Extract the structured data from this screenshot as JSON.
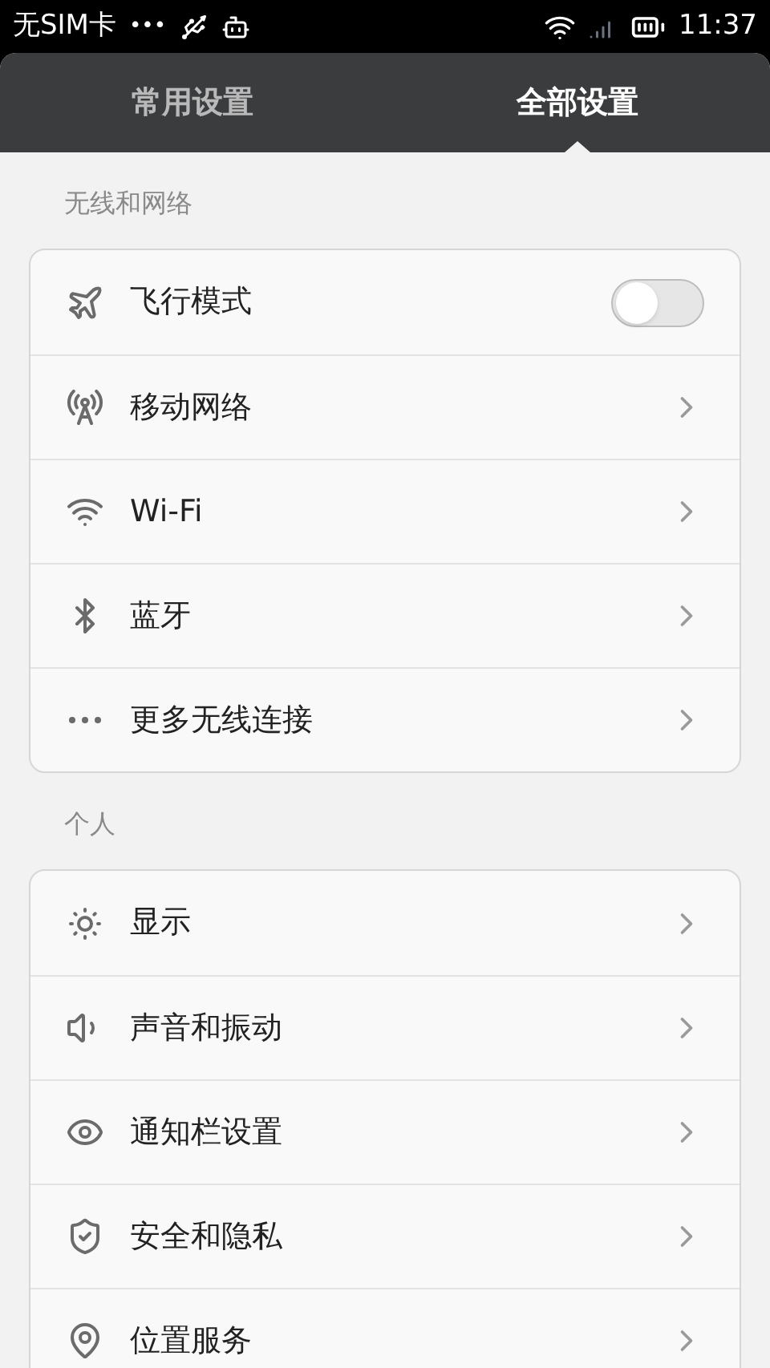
{
  "status_bar": {
    "carrier": "无SIM卡",
    "dots": "•••",
    "time": "11:37"
  },
  "tabs": [
    {
      "label": "常用设置",
      "selected": false
    },
    {
      "label": "全部设置",
      "selected": true
    }
  ],
  "sections": [
    {
      "title": "无线和网络",
      "items": [
        {
          "label": "飞行模式",
          "kind": "toggle",
          "on": false
        },
        {
          "label": "移动网络",
          "kind": "link"
        },
        {
          "label": "Wi-Fi",
          "kind": "link"
        },
        {
          "label": "蓝牙",
          "kind": "link"
        },
        {
          "label": "更多无线连接",
          "kind": "link"
        }
      ]
    },
    {
      "title": "个人",
      "items": [
        {
          "label": "显示",
          "kind": "link"
        },
        {
          "label": "声音和振动",
          "kind": "link"
        },
        {
          "label": "通知栏设置",
          "kind": "link"
        },
        {
          "label": "安全和隐私",
          "kind": "link"
        },
        {
          "label": "位置服务",
          "kind": "link"
        }
      ]
    }
  ]
}
